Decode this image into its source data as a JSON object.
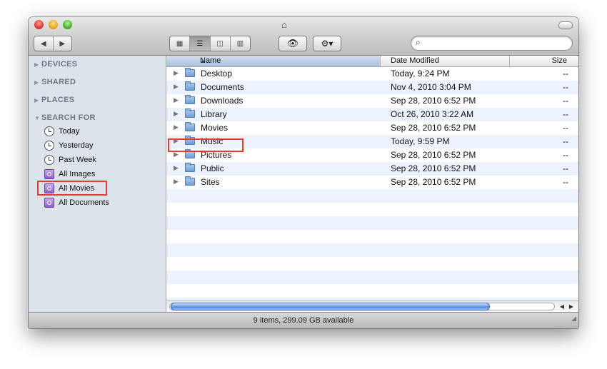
{
  "window": {
    "title_icon": "home-icon"
  },
  "toolbar": {
    "back_label": "◀",
    "forward_label": "▶",
    "view_icons_label": "▦",
    "view_list_label": "☰",
    "view_columns_label": "◫",
    "view_coverflow_label": "▥",
    "quicklook_label": "👁",
    "action_label": "⚙▾",
    "search_icon": "🔍",
    "search_value": "",
    "search_placeholder": ""
  },
  "sidebar": {
    "sections": [
      {
        "label": "DEVICES",
        "expanded": false
      },
      {
        "label": "SHARED",
        "expanded": false
      },
      {
        "label": "PLACES",
        "expanded": false
      },
      {
        "label": "SEARCH FOR",
        "expanded": true
      }
    ],
    "search_items": [
      {
        "label": "Today",
        "icon": "clock-icon"
      },
      {
        "label": "Yesterday",
        "icon": "clock-icon"
      },
      {
        "label": "Past Week",
        "icon": "clock-icon"
      },
      {
        "label": "All Images",
        "icon": "smart-folder-icon"
      },
      {
        "label": "All Movies",
        "icon": "smart-folder-icon",
        "highlighted": true
      },
      {
        "label": "All Documents",
        "icon": "smart-folder-icon"
      }
    ]
  },
  "columns": {
    "name": "Name",
    "date": "Date Modified",
    "size": "Size",
    "sort_indicator": "▲"
  },
  "rows": [
    {
      "name": "Desktop",
      "date": "Today, 9:24 PM",
      "size": "--"
    },
    {
      "name": "Documents",
      "date": "Nov 4, 2010 3:04 PM",
      "size": "--"
    },
    {
      "name": "Downloads",
      "date": "Sep 28, 2010 6:52 PM",
      "size": "--"
    },
    {
      "name": "Library",
      "date": "Oct 26, 2010 3:22 AM",
      "size": "--"
    },
    {
      "name": "Movies",
      "date": "Sep 28, 2010 6:52 PM",
      "size": "--",
      "highlighted": true
    },
    {
      "name": "Music",
      "date": "Today, 9:59 PM",
      "size": "--"
    },
    {
      "name": "Pictures",
      "date": "Sep 28, 2010 6:52 PM",
      "size": "--"
    },
    {
      "name": "Public",
      "date": "Sep 28, 2010 6:52 PM",
      "size": "--"
    },
    {
      "name": "Sites",
      "date": "Sep 28, 2010 6:52 PM",
      "size": "--"
    }
  ],
  "status": {
    "text": "9 items, 299.09 GB available"
  },
  "colors": {
    "highlight": "#e53b30",
    "sidebar_bg": "#dde3ea",
    "row_alt": "#edf3fe"
  }
}
